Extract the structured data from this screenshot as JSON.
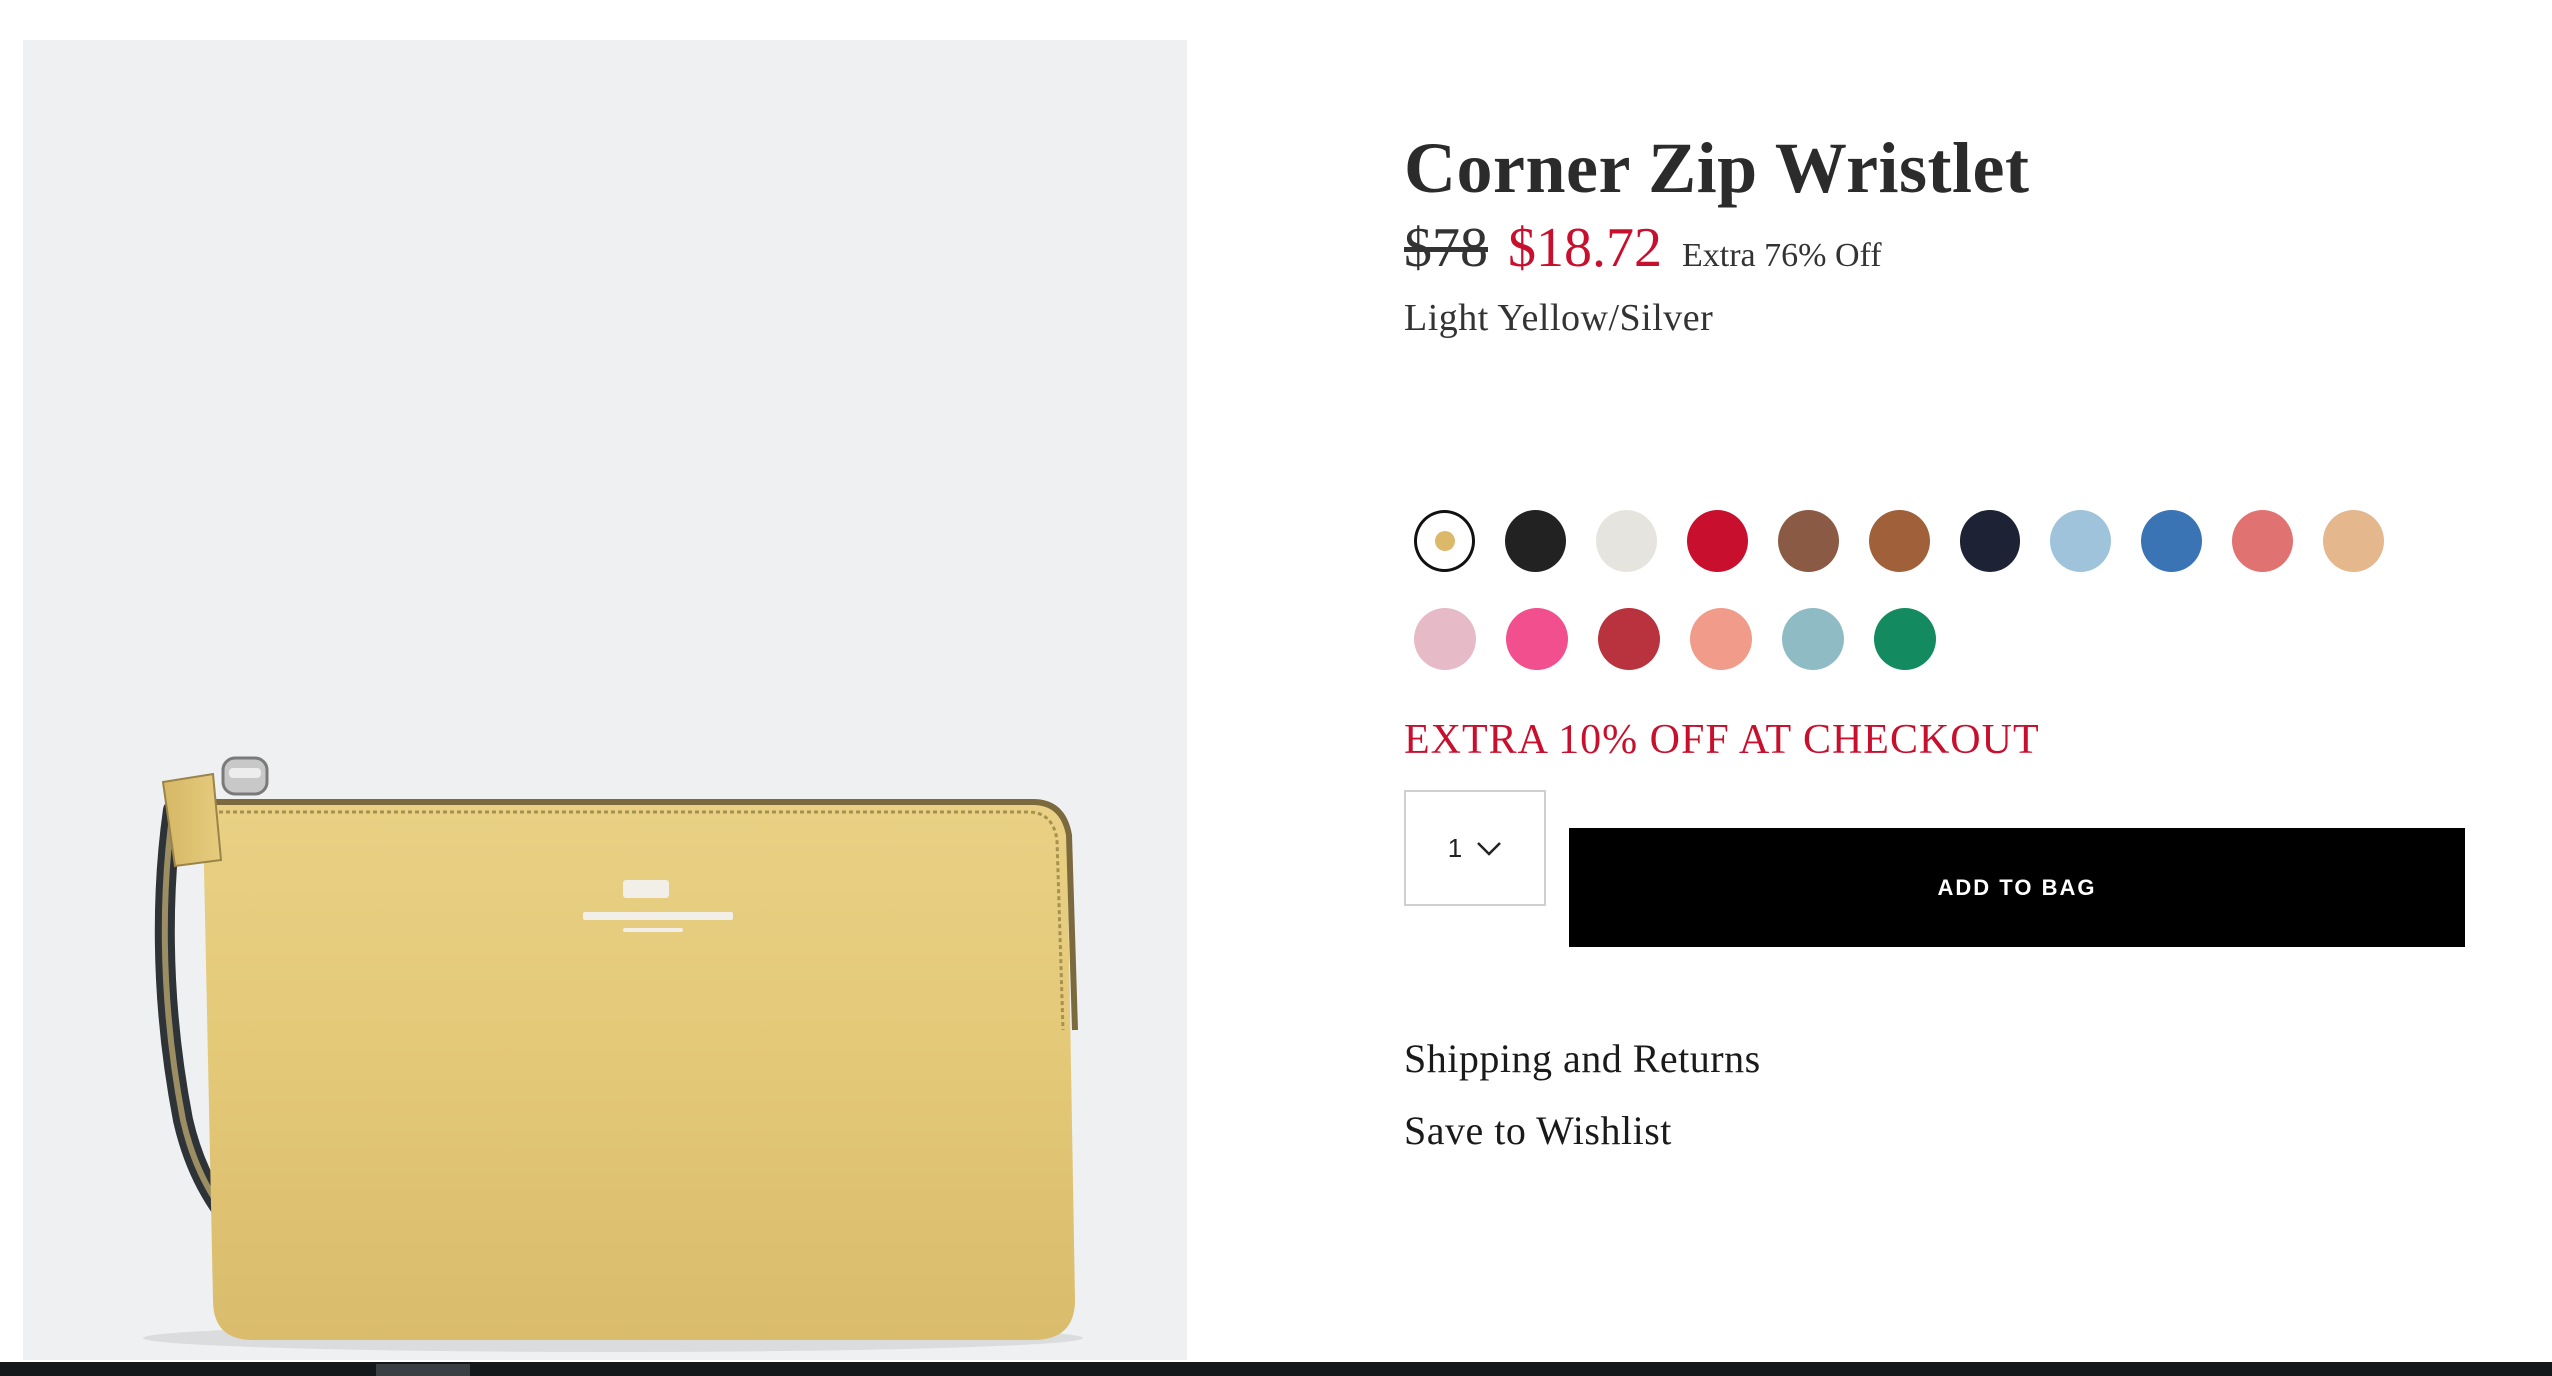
{
  "product": {
    "title": "Corner Zip Wristlet",
    "price_original": "$78",
    "price_sale": "$18.72",
    "discount_note": "Extra 76% Off",
    "color_name": "Light Yellow/Silver"
  },
  "swatches": {
    "row1": [
      {
        "name": "light-yellow",
        "color": "#ffffff",
        "selected": true
      },
      {
        "name": "black",
        "color": "#222222"
      },
      {
        "name": "chalk",
        "color": "#e6e4de"
      },
      {
        "name": "red",
        "color": "#c8102e"
      },
      {
        "name": "brown",
        "color": "#8a5a44"
      },
      {
        "name": "saddle",
        "color": "#a0613a"
      },
      {
        "name": "navy",
        "color": "#1d2235"
      },
      {
        "name": "light-blue",
        "color": "#9ec3da"
      },
      {
        "name": "blue",
        "color": "#3a74b5"
      },
      {
        "name": "coral",
        "color": "#e07372"
      },
      {
        "name": "beechwood",
        "color": "#e4b78d"
      }
    ],
    "row2": [
      {
        "name": "blush",
        "color": "#e7bac8"
      },
      {
        "name": "pink",
        "color": "#f24f8f"
      },
      {
        "name": "deep-red",
        "color": "#b8333e"
      },
      {
        "name": "peach",
        "color": "#f19c8b"
      },
      {
        "name": "sage-blue",
        "color": "#8fbcc4"
      },
      {
        "name": "green",
        "color": "#148a60"
      }
    ]
  },
  "promo": {
    "text": "EXTRA 10% OFF AT CHECKOUT"
  },
  "quantity": {
    "value": "1"
  },
  "actions": {
    "add_to_bag": "ADD TO BAG",
    "shipping_returns": "Shipping and Returns",
    "save_wishlist": "Save to Wishlist"
  },
  "colors": {
    "sale_red": "#c8102e",
    "button_black": "#000000",
    "image_bg": "#eef0f1",
    "wristlet_yellow": "#e8cd7e"
  }
}
